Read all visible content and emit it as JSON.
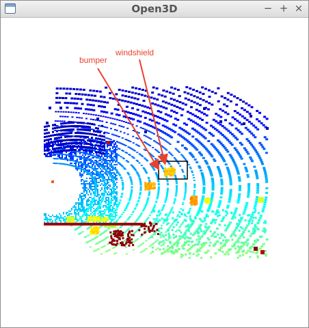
{
  "window": {
    "title": "Open3D",
    "controls": {
      "minimize": "−",
      "maximize": "+",
      "close": "×"
    }
  },
  "annotations": {
    "bumper": "bumper",
    "windshield": "windshield",
    "color": "#e8412c"
  },
  "viewport": {
    "description_icons": [
      "window-app-icon"
    ],
    "colormap": "jet",
    "highlight_box_color": "#000000"
  }
}
